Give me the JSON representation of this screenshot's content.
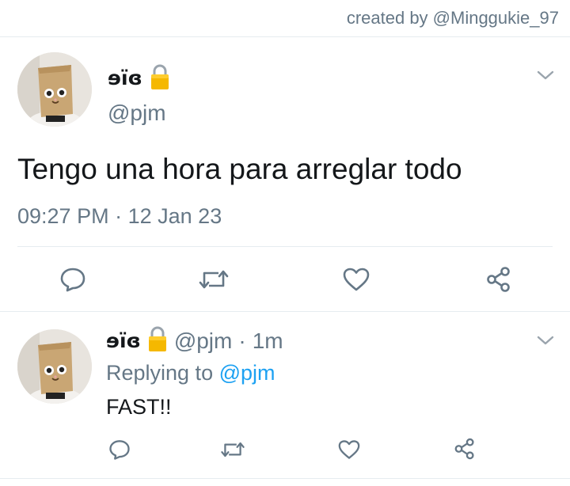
{
  "credit": "created by @Minggukie_97",
  "main_tweet": {
    "name": "ɘïɞ",
    "handle": "@pjm",
    "text": "Tengo una hora para arreglar todo",
    "time": "09:27 PM",
    "separator": "·",
    "date": "12 Jan 23"
  },
  "reply_tweet": {
    "name": "ɘïɞ",
    "handle": "@pjm",
    "separator": "·",
    "age": "1m",
    "replying_prefix": "Replying to",
    "replying_mention": "@pjm",
    "text": "FAST!!"
  },
  "icons": {
    "reply": "reply-icon",
    "retweet": "retweet-icon",
    "like": "heart-icon",
    "share": "share-icon",
    "lock": "lock-icon",
    "more": "chevron-down-icon"
  },
  "colors": {
    "icon": "#657786",
    "link": "#1da1f2",
    "divider": "#e6ecf0",
    "lock": "#f5b800"
  }
}
